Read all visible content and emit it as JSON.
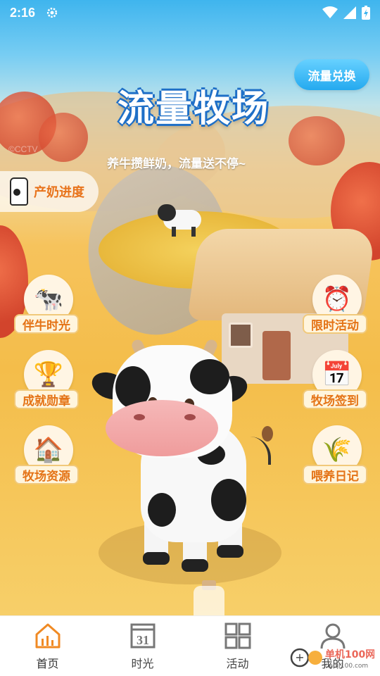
{
  "status_bar": {
    "time": "2:16",
    "icons": [
      "gear-icon",
      "wifi-icon",
      "signal-icon",
      "battery-charging-icon"
    ]
  },
  "header": {
    "exchange_label": "流量兑换",
    "title": "流量牧场",
    "subtitle": "养牛攒鲜奶，流量送不停~",
    "watermark": "©CCTV"
  },
  "progress": {
    "label": "产奶进度"
  },
  "actions_left": [
    {
      "label": "伴牛时光",
      "icon": "cow-companion-icon"
    },
    {
      "label": "成就勋章",
      "icon": "trophy-icon"
    },
    {
      "label": "牧场资源",
      "icon": "barn-icon"
    }
  ],
  "actions_right": [
    {
      "label": "限时活动",
      "icon": "timer-gift-icon"
    },
    {
      "label": "牧场签到",
      "icon": "calendar-check-icon"
    },
    {
      "label": "喂养日记",
      "icon": "wheat-icon"
    }
  ],
  "nav": {
    "items": [
      {
        "label": "首页",
        "icon": "home-chart-icon",
        "active": true
      },
      {
        "label": "时光",
        "icon": "calendar-icon",
        "day": "31"
      },
      {
        "label": "活动",
        "icon": "grid-icon"
      },
      {
        "label": "我的",
        "icon": "user-icon"
      }
    ]
  },
  "corner_logo": {
    "text": "单机100网",
    "url_text": "danji100.com"
  },
  "colors": {
    "accent": "#e47316",
    "sky": "#3fb5ee",
    "title_outline": "#1e6fc7",
    "nav_active": "#f08a24"
  }
}
